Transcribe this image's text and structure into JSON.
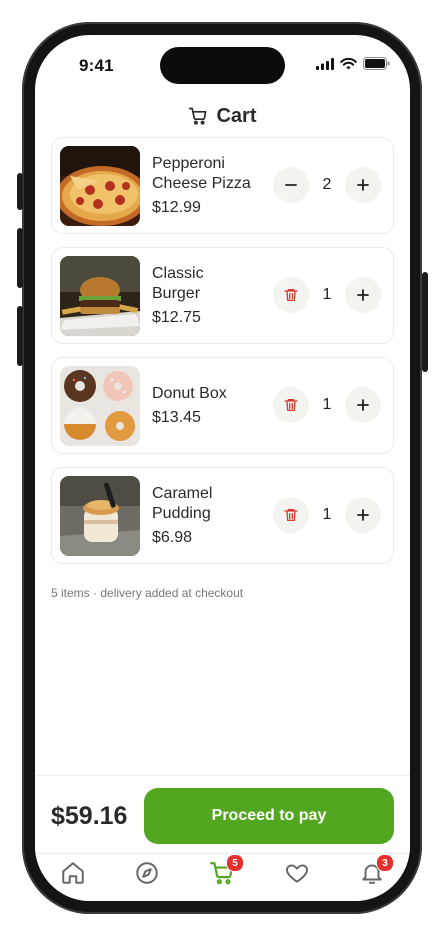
{
  "status_bar": {
    "time": "9:41"
  },
  "header": {
    "title": "Cart"
  },
  "items": [
    {
      "name_line1": "Pepperoni",
      "name_line2": "Cheese Pizza",
      "price": "$12.99",
      "qty": "2",
      "left_action": "minus-icon"
    },
    {
      "name_line1": "Classic",
      "name_line2": "Burger",
      "price": "$12.75",
      "qty": "1",
      "left_action": "trash-icon"
    },
    {
      "name_line1": "Donut Box",
      "name_line2": "",
      "price": "$13.45",
      "qty": "1",
      "left_action": "trash-icon"
    },
    {
      "name_line1": "Caramel",
      "name_line2": "Pudding",
      "price": "$6.98",
      "qty": "1",
      "left_action": "trash-icon"
    }
  ],
  "note": "5 items · delivery added at checkout",
  "footer": {
    "total": "$59.16",
    "pay_label": "Proceed to pay"
  },
  "tabbar": {
    "tabs": [
      "home-icon",
      "compass-icon",
      "cart-icon",
      "heart-icon",
      "bell-icon"
    ],
    "cart_badge": "5",
    "bell_badge": "3",
    "active": "cart"
  },
  "colors": {
    "accent": "#52a620",
    "badge": "#e5302e",
    "trash": "#d73a2e"
  }
}
